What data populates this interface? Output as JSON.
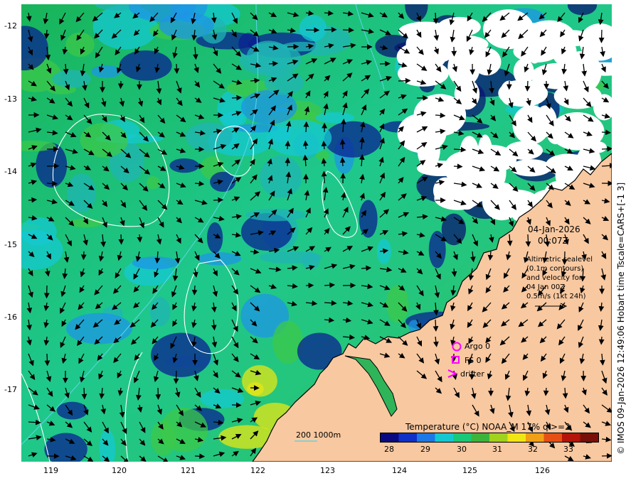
{
  "map": {
    "lon_labels": [
      "119",
      "120",
      "121",
      "122",
      "123",
      "124",
      "125",
      "126"
    ],
    "lat_labels": [
      "-12",
      "-13",
      "-14",
      "-15",
      "-16",
      "-17"
    ]
  },
  "annotation": {
    "date": "04-Jan-2026",
    "time": "00:07Z",
    "desc_lines": [
      "Altimetric sealevel",
      "(0.1m contours)",
      "and velocity for",
      "04 Jan 00Z",
      "0.5m/s (1kt 24h)"
    ]
  },
  "legend": {
    "items": [
      {
        "symbol": "circle",
        "label": "Argo 0"
      },
      {
        "symbol": "square",
        "label": "FS 0"
      },
      {
        "symbol": "chevron",
        "label": "drifter"
      }
    ],
    "symbol_color": "#ff00ff"
  },
  "isobath": {
    "label": "200 1000m",
    "color": "#5fd3e8"
  },
  "colorbar": {
    "title": "Temperature (°C) NOAA_M 17% ql>=2",
    "ticks": [
      "28",
      "29",
      "30",
      "31",
      "32",
      "33"
    ],
    "colors": [
      "#0a0a80",
      "#1030c8",
      "#1e78e6",
      "#14c8d2",
      "#18c878",
      "#3cb43c",
      "#a0d21e",
      "#f0e614",
      "#f0a014",
      "#e65014",
      "#b4140a",
      "#781008"
    ]
  },
  "side_credit": "© IMOS 09-Jan-2026 12:49:06 Hobart time Tscale=CARS+[-1 3]",
  "colors": {
    "land": "#f8c8a0",
    "coast": "#000000",
    "contour": "#ffffff",
    "ocean_base": "#22b464"
  }
}
